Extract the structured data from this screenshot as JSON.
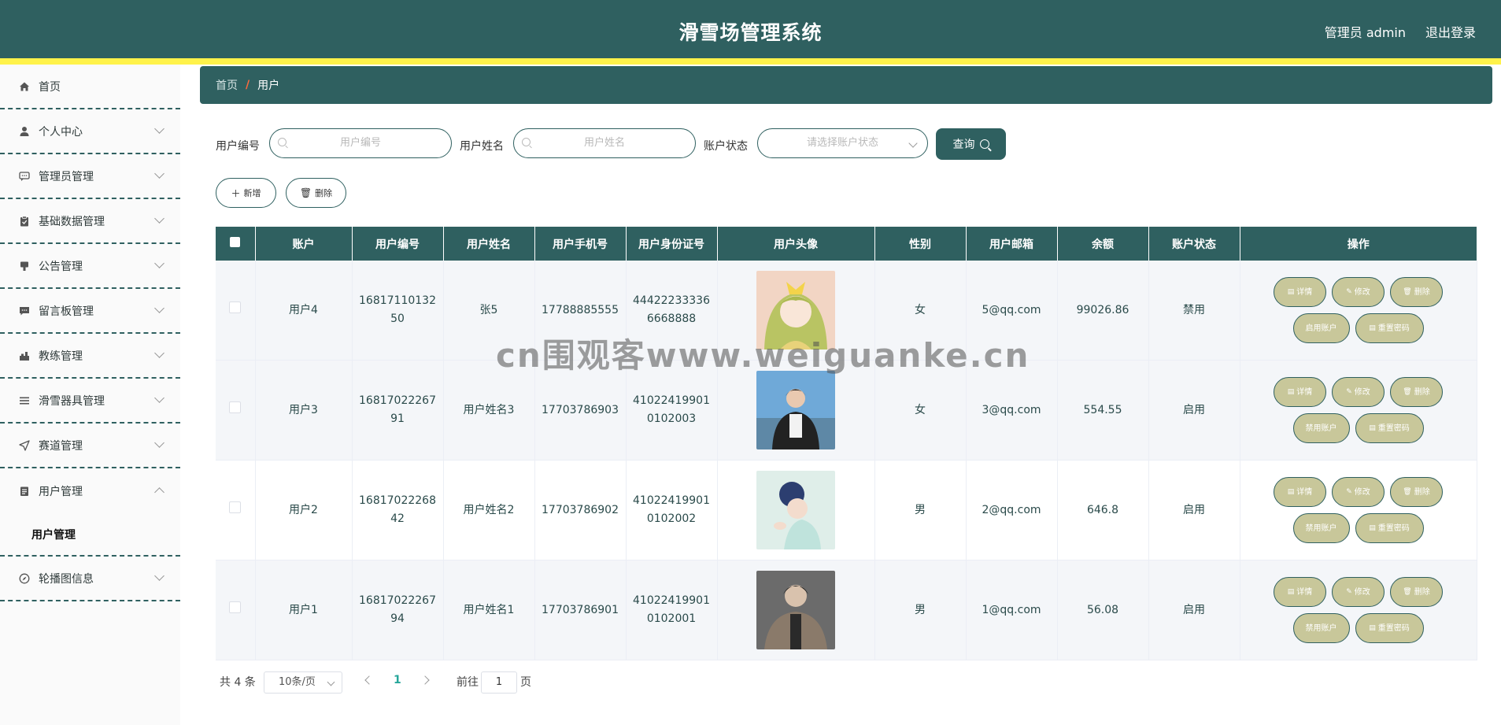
{
  "header": {
    "title": "滑雪场管理系统",
    "user_label": "管理员 admin",
    "logout_label": "退出登录"
  },
  "sidebar": {
    "items": [
      {
        "label": "首页",
        "icon": "home-icon",
        "expandable": false
      },
      {
        "label": "个人中心",
        "icon": "user-icon",
        "expandable": true
      },
      {
        "label": "管理员管理",
        "icon": "chat-icon",
        "expandable": true
      },
      {
        "label": "基础数据管理",
        "icon": "clipboard-icon",
        "expandable": true
      },
      {
        "label": "公告管理",
        "icon": "megaphone-icon",
        "expandable": true
      },
      {
        "label": "留言板管理",
        "icon": "message-icon",
        "expandable": true
      },
      {
        "label": "教练管理",
        "icon": "coach-icon",
        "expandable": true
      },
      {
        "label": "滑雪器具管理",
        "icon": "list-icon",
        "expandable": true
      },
      {
        "label": "赛道管理",
        "icon": "send-icon",
        "expandable": true
      },
      {
        "label": "用户管理",
        "icon": "document-icon",
        "expandable": true,
        "open": true,
        "children": [
          "用户管理"
        ]
      },
      {
        "label": "轮播图信息",
        "icon": "compass-icon",
        "expandable": true
      }
    ]
  },
  "breadcrumb": {
    "home": "首页",
    "separator": "/",
    "current": "用户"
  },
  "search": {
    "user_no_label": "用户编号",
    "user_no_placeholder": "用户编号",
    "user_name_label": "用户姓名",
    "user_name_placeholder": "用户姓名",
    "status_label": "账户状态",
    "status_placeholder": "请选择账户状态",
    "query_label": "查询"
  },
  "actions": {
    "add_label": "新增",
    "delete_label": "删除"
  },
  "table": {
    "columns": [
      "账户",
      "用户编号",
      "用户姓名",
      "用户手机号",
      "用户身份证号",
      "用户头像",
      "性别",
      "用户邮箱",
      "余额",
      "账户状态",
      "操作"
    ],
    "rows": [
      {
        "account": "用户4",
        "user_no": "1681711013250",
        "name": "张5",
        "phone": "17788885555",
        "id_card": "444222333366668888",
        "gender": "女",
        "email": "5@qq.com",
        "balance": "99026.86",
        "status": "禁用",
        "toggle_label": "启用账户"
      },
      {
        "account": "用户3",
        "user_no": "1681702226791",
        "name": "用户姓名3",
        "phone": "17703786903",
        "id_card": "410224199010102003",
        "gender": "女",
        "email": "3@qq.com",
        "balance": "554.55",
        "status": "启用",
        "toggle_label": "禁用账户"
      },
      {
        "account": "用户2",
        "user_no": "1681702226842",
        "name": "用户姓名2",
        "phone": "17703786902",
        "id_card": "410224199010102002",
        "gender": "男",
        "email": "2@qq.com",
        "balance": "646.8",
        "status": "启用",
        "toggle_label": "禁用账户"
      },
      {
        "account": "用户1",
        "user_no": "1681702226794",
        "name": "用户姓名1",
        "phone": "17703786901",
        "id_card": "410224199010102001",
        "gender": "男",
        "email": "1@qq.com",
        "balance": "56.08",
        "status": "启用",
        "toggle_label": "禁用账户"
      }
    ],
    "op_labels": {
      "detail": "详情",
      "edit": "修改",
      "delete": "删除",
      "reset": "重置密码"
    }
  },
  "pagination": {
    "total": "共 4 条",
    "page_size": "10条/页",
    "current_page": "1",
    "goto_prefix": "前往",
    "goto_value": "1",
    "goto_suffix": "页"
  },
  "watermark": "cn围观客www.weiguanke.cn",
  "colors": {
    "primary": "#2f6060",
    "accent_bar": "#fff24a",
    "op_button": "#c8c79a",
    "breadcrumb_sep": "#ff6a3d"
  }
}
